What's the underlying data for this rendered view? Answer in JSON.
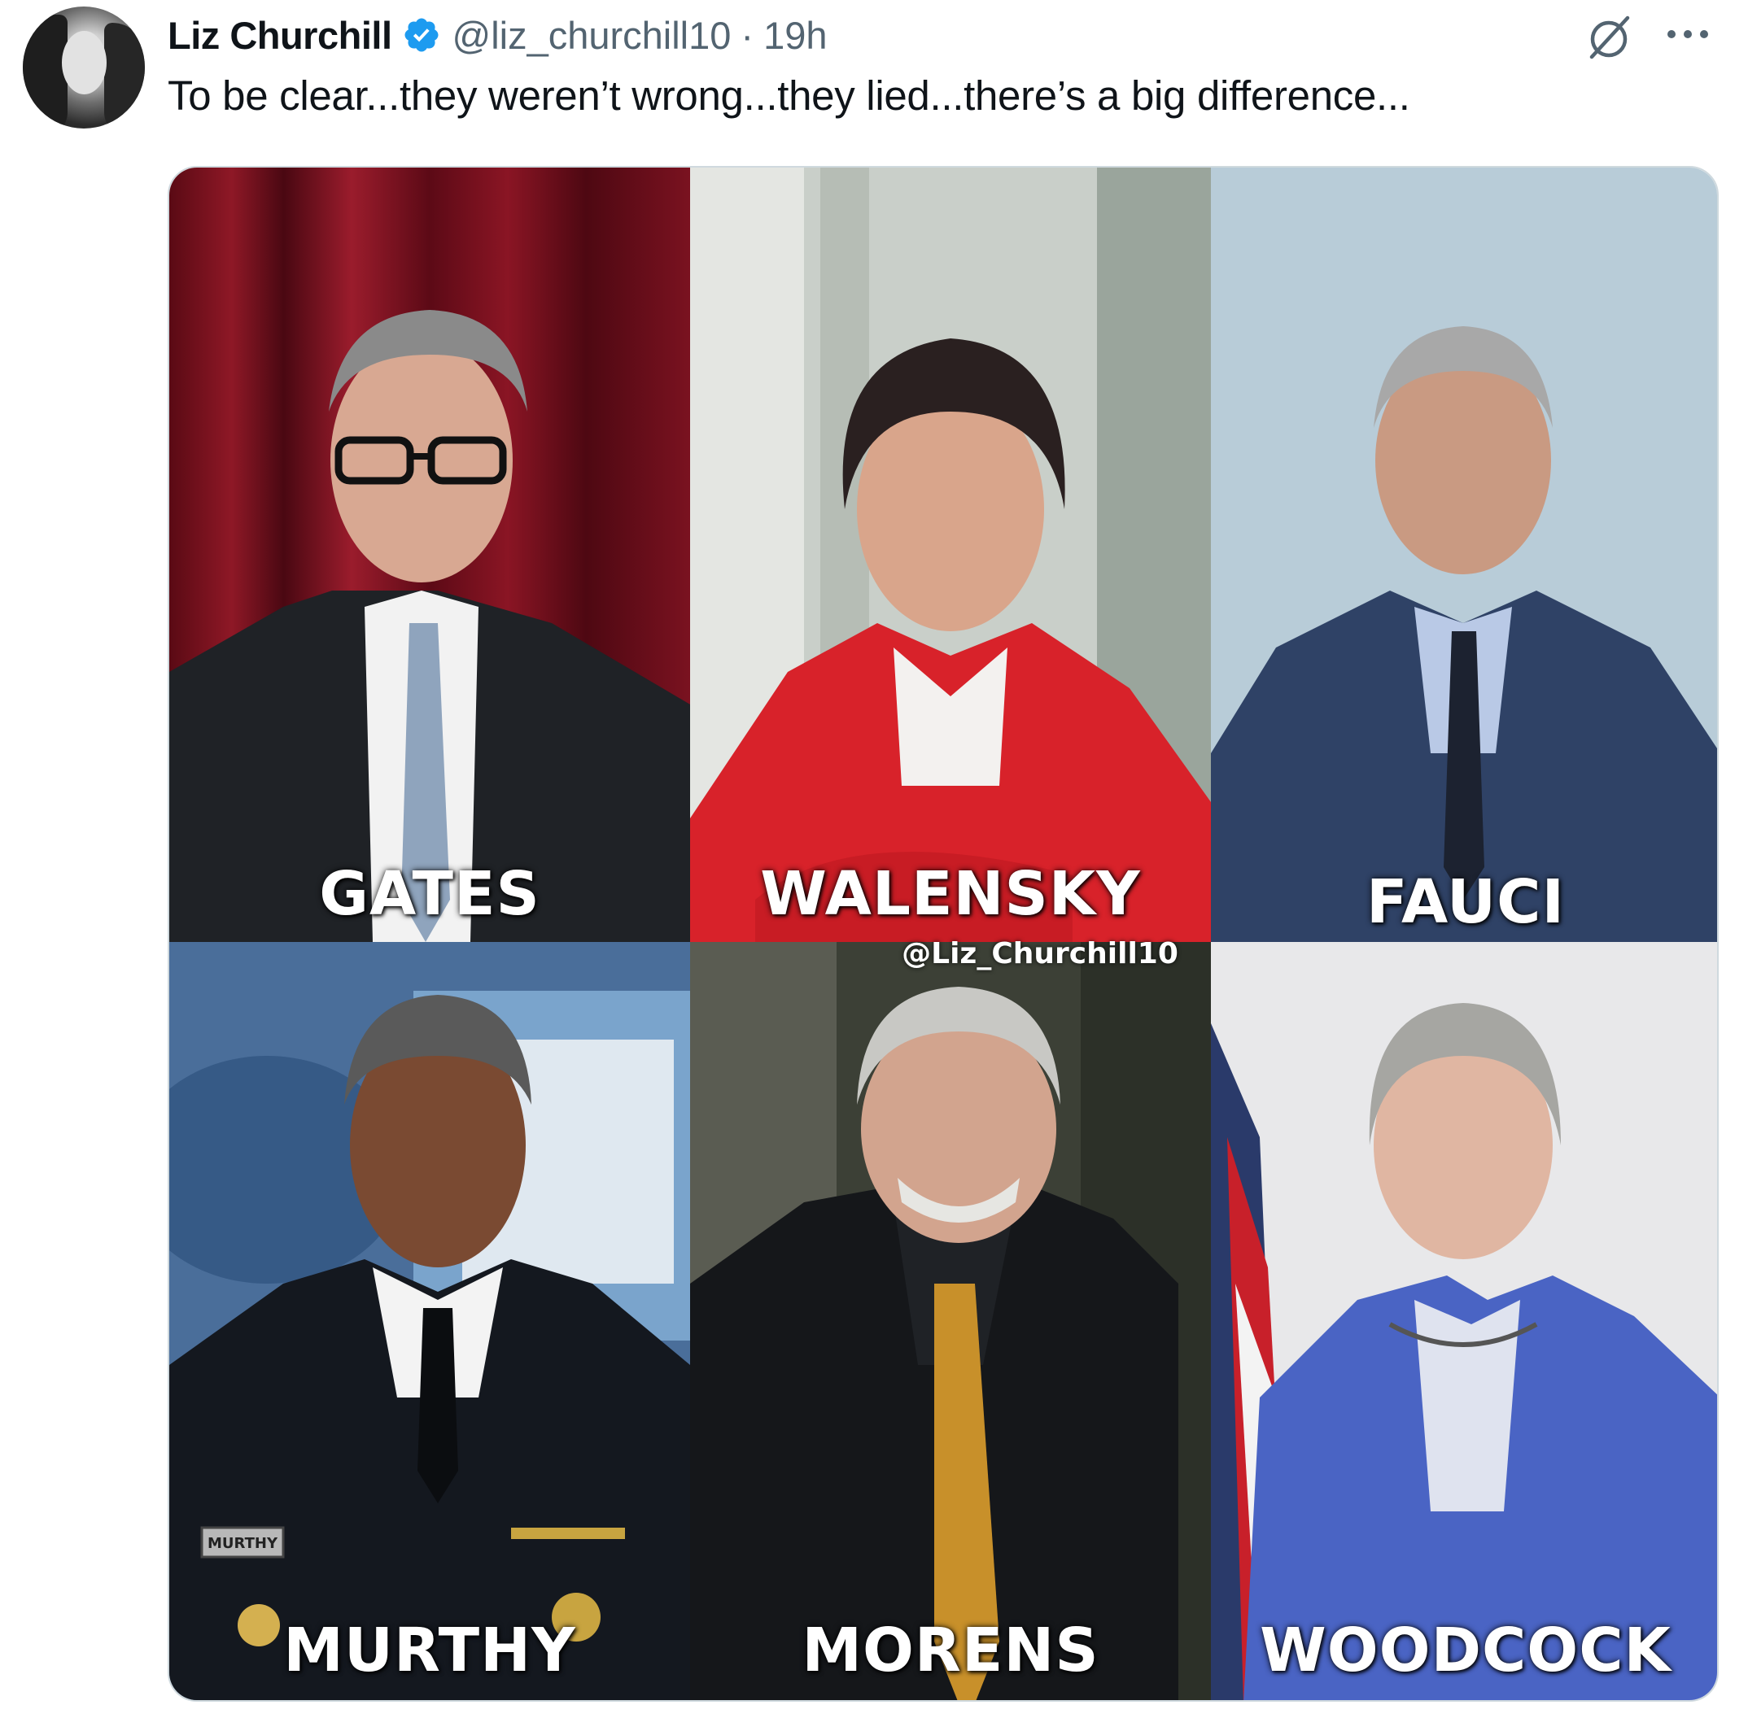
{
  "post": {
    "author_name": "Liz Churchill",
    "handle": "@liz_churchill10",
    "separator": "·",
    "time": "19h",
    "text": "To be clear...they weren’t wrong...they lied...there’s a big difference..."
  },
  "icons": {
    "verified": "verified-badge-icon",
    "grok": "grok-icon",
    "more": "more-options-icon"
  },
  "colors": {
    "verified_blue": "#1d9bf0",
    "text_primary": "#0f1419",
    "text_secondary": "#536471"
  },
  "image": {
    "watermark": "@Liz_Churchill10",
    "tiles": [
      {
        "label": "GATES"
      },
      {
        "label": "WALENSKY"
      },
      {
        "label": "FAUCI"
      },
      {
        "label": "MURTHY"
      },
      {
        "label": "MORENS"
      },
      {
        "label": "WOODCOCK"
      }
    ],
    "badge_text": "MURTHY"
  }
}
